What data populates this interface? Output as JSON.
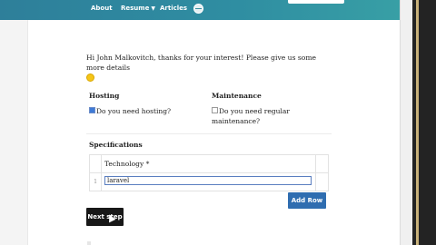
{
  "nav": {
    "items": [
      "About",
      "Resume",
      "Articles"
    ],
    "resume_chevron": "chevron-down-icon"
  },
  "intro": {
    "text": "Hi John Malkovitch, thanks for your interest! Please give us some more details",
    "emoji": "smile-emoji-icon"
  },
  "hosting": {
    "heading": "Hosting",
    "checkbox_label": "Do you need hosting?",
    "checked": true
  },
  "maintenance": {
    "heading": "Maintenance",
    "checkbox_label_line1": "Do you need regular",
    "checkbox_label_line2": "maintenance?",
    "checked": false
  },
  "specifications": {
    "heading": "Specifications",
    "column_header": "Technology *",
    "rows": [
      {
        "number": "1",
        "value": "laravel"
      }
    ],
    "add_row_label": "Add Row"
  },
  "next_step_label": "Next step",
  "colors": {
    "nav_gradient_start": "#2e7f9a",
    "nav_gradient_end": "#3aa3a6",
    "add_row_button": "#2f6db0",
    "next_button": "#181818"
  }
}
